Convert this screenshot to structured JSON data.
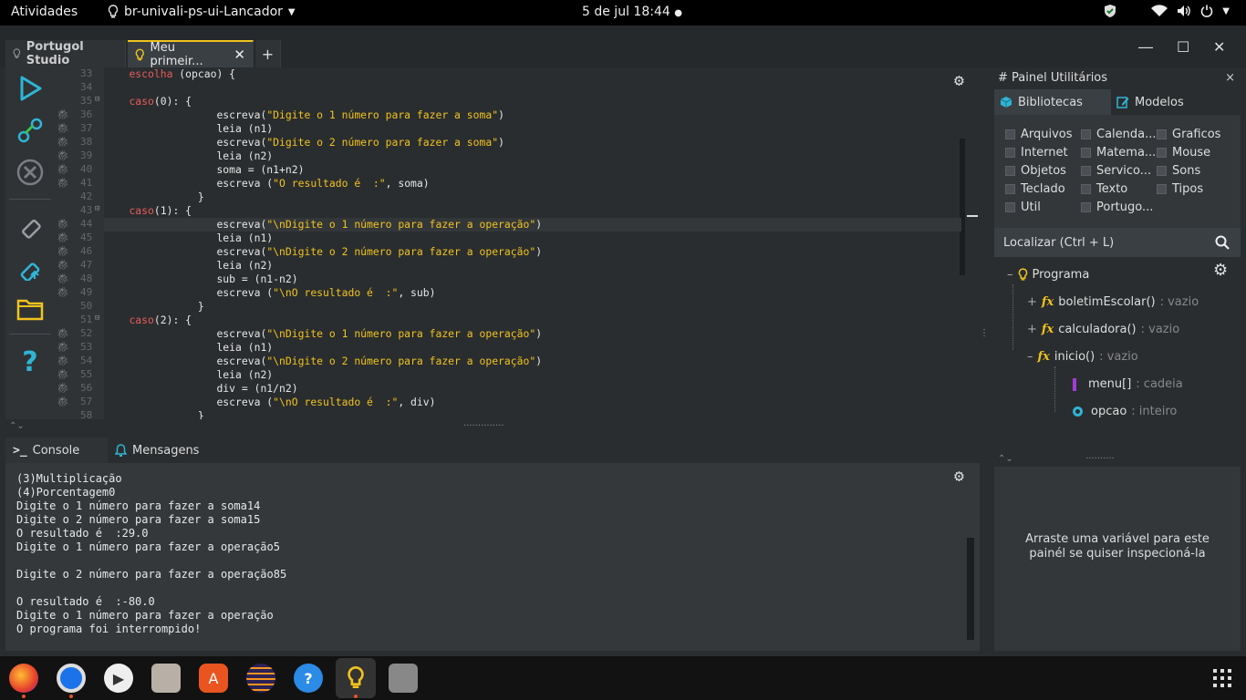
{
  "topbar": {
    "activities": "Atividades",
    "app_name": "br-univali-ps-ui-Lancador",
    "clock": "5 de jul  18:44"
  },
  "tabs": {
    "home": "Portugol Studio",
    "file": "Meu primeir...",
    "new": "+"
  },
  "editor": {
    "gutter": [
      {
        "n": "33",
        "bug": false,
        "fold": ""
      },
      {
        "n": "34",
        "bug": false,
        "fold": ""
      },
      {
        "n": "35",
        "bug": false,
        "fold": "⊟"
      },
      {
        "n": "36",
        "bug": true,
        "fold": ""
      },
      {
        "n": "37",
        "bug": true,
        "fold": ""
      },
      {
        "n": "38",
        "bug": true,
        "fold": ""
      },
      {
        "n": "39",
        "bug": true,
        "fold": ""
      },
      {
        "n": "40",
        "bug": true,
        "fold": ""
      },
      {
        "n": "41",
        "bug": true,
        "fold": ""
      },
      {
        "n": "42",
        "bug": false,
        "fold": ""
      },
      {
        "n": "43",
        "bug": false,
        "fold": "⊟"
      },
      {
        "n": "44",
        "bug": true,
        "fold": ""
      },
      {
        "n": "45",
        "bug": true,
        "fold": ""
      },
      {
        "n": "46",
        "bug": true,
        "fold": ""
      },
      {
        "n": "47",
        "bug": true,
        "fold": ""
      },
      {
        "n": "48",
        "bug": true,
        "fold": ""
      },
      {
        "n": "49",
        "bug": true,
        "fold": ""
      },
      {
        "n": "50",
        "bug": false,
        "fold": ""
      },
      {
        "n": "51",
        "bug": false,
        "fold": "⊟"
      },
      {
        "n": "52",
        "bug": true,
        "fold": ""
      },
      {
        "n": "53",
        "bug": true,
        "fold": ""
      },
      {
        "n": "54",
        "bug": true,
        "fold": ""
      },
      {
        "n": "55",
        "bug": true,
        "fold": ""
      },
      {
        "n": "56",
        "bug": true,
        "fold": ""
      },
      {
        "n": "57",
        "bug": true,
        "fold": ""
      },
      {
        "n": "58",
        "bug": false,
        "fold": ""
      }
    ],
    "lines": [
      [
        {
          "t": "    "
        },
        {
          "t": "escolha",
          "c": "kw"
        },
        {
          "t": " (opcao) {"
        }
      ],
      [
        {
          "t": ""
        }
      ],
      [
        {
          "t": "    "
        },
        {
          "t": "caso",
          "c": "kw"
        },
        {
          "t": "(0): {"
        }
      ],
      [
        {
          "t": "                  escreva("
        },
        {
          "t": "\"Digite o 1 número para fazer a soma\"",
          "c": "str"
        },
        {
          "t": ")"
        }
      ],
      [
        {
          "t": "                  leia (n1)"
        }
      ],
      [
        {
          "t": "                  escreva("
        },
        {
          "t": "\"Digite o 2 número para fazer a soma\"",
          "c": "str"
        },
        {
          "t": ")"
        }
      ],
      [
        {
          "t": "                  leia (n2)"
        }
      ],
      [
        {
          "t": "                  soma = (n1+n2)"
        }
      ],
      [
        {
          "t": "                  escreva ("
        },
        {
          "t": "\"O resultado é  :\"",
          "c": "str"
        },
        {
          "t": ", soma)"
        }
      ],
      [
        {
          "t": "               }"
        }
      ],
      [
        {
          "t": "    "
        },
        {
          "t": "caso",
          "c": "kw"
        },
        {
          "t": "(1): {"
        }
      ],
      [
        {
          "t": "                  escreva("
        },
        {
          "t": "\"\\nDigite o 1 número para fazer a operação\"",
          "c": "str"
        },
        {
          "t": ")"
        }
      ],
      [
        {
          "t": "                  leia (n1)"
        }
      ],
      [
        {
          "t": "                  escreva("
        },
        {
          "t": "\"\\nDigite o 2 número para fazer a operação\"",
          "c": "str"
        },
        {
          "t": ")"
        }
      ],
      [
        {
          "t": "                  leia (n2)"
        }
      ],
      [
        {
          "t": "                  sub = (n1-n2)"
        }
      ],
      [
        {
          "t": "                  escreva ("
        },
        {
          "t": "\"\\nO resultado é  :\"",
          "c": "str"
        },
        {
          "t": ", sub)"
        }
      ],
      [
        {
          "t": "               }"
        }
      ],
      [
        {
          "t": "    "
        },
        {
          "t": "caso",
          "c": "kw"
        },
        {
          "t": "(2): {"
        }
      ],
      [
        {
          "t": "                  escreva("
        },
        {
          "t": "\"\\nDigite o 1 número para fazer a operação\"",
          "c": "str"
        },
        {
          "t": ")"
        }
      ],
      [
        {
          "t": "                  leia (n1)"
        }
      ],
      [
        {
          "t": "                  escreva("
        },
        {
          "t": "\"\\nDigite o 2 número para fazer a operação\"",
          "c": "str"
        },
        {
          "t": ")"
        }
      ],
      [
        {
          "t": "                  leia (n2)"
        }
      ],
      [
        {
          "t": "                  div = (n1/n2)"
        }
      ],
      [
        {
          "t": "                  escreva ("
        },
        {
          "t": "\"\\nO resultado é  :\"",
          "c": "str"
        },
        {
          "t": ", div)"
        }
      ],
      [
        {
          "t": "               }"
        }
      ]
    ],
    "highlight_line": 11
  },
  "bottom_tabs": {
    "console": "Console",
    "messages": "Mensagens"
  },
  "console": {
    "lines": [
      "(3)Multiplicação",
      "(4)Porcentagem0",
      "Digite o 1 número para fazer a soma14",
      "Digite o 2 número para fazer a soma15",
      "O resultado é  :29.0",
      "Digite o 1 número para fazer a operação5",
      "",
      "Digite o 2 número para fazer a operação85",
      "",
      "O resultado é  :-80.0",
      "Digite o 1 número para fazer a operação",
      "O programa foi interrompido!"
    ]
  },
  "right_panel": {
    "title": "# Painel Utilitários",
    "close": "×",
    "tab_libs": "Bibliotecas",
    "tab_models": "Modelos",
    "libraries": [
      "Arquivos",
      "Calenda...",
      "Graficos",
      "Internet",
      "Matema...",
      "Mouse",
      "Objetos",
      "Servico...",
      "Sons",
      "Teclado",
      "Texto",
      "Tipos",
      "Util",
      "Portugo..."
    ],
    "search": "Localizar (Ctrl + L)",
    "tree": {
      "root": "Programa",
      "f1": "boletimEscolar()",
      "f1_type": " : vazio",
      "f2": "calculadora()",
      "f2_type": " : vazio",
      "f3": "inicio()",
      "f3_type": " : vazio",
      "v1": "menu[]",
      "v1_type": " : cadeia",
      "v2": "opcao",
      "v2_type": " : inteiro"
    },
    "inspect_text": "Arraste uma variável para este painél se quiser inspecioná-la"
  },
  "icons": {
    "fx": "fx"
  }
}
